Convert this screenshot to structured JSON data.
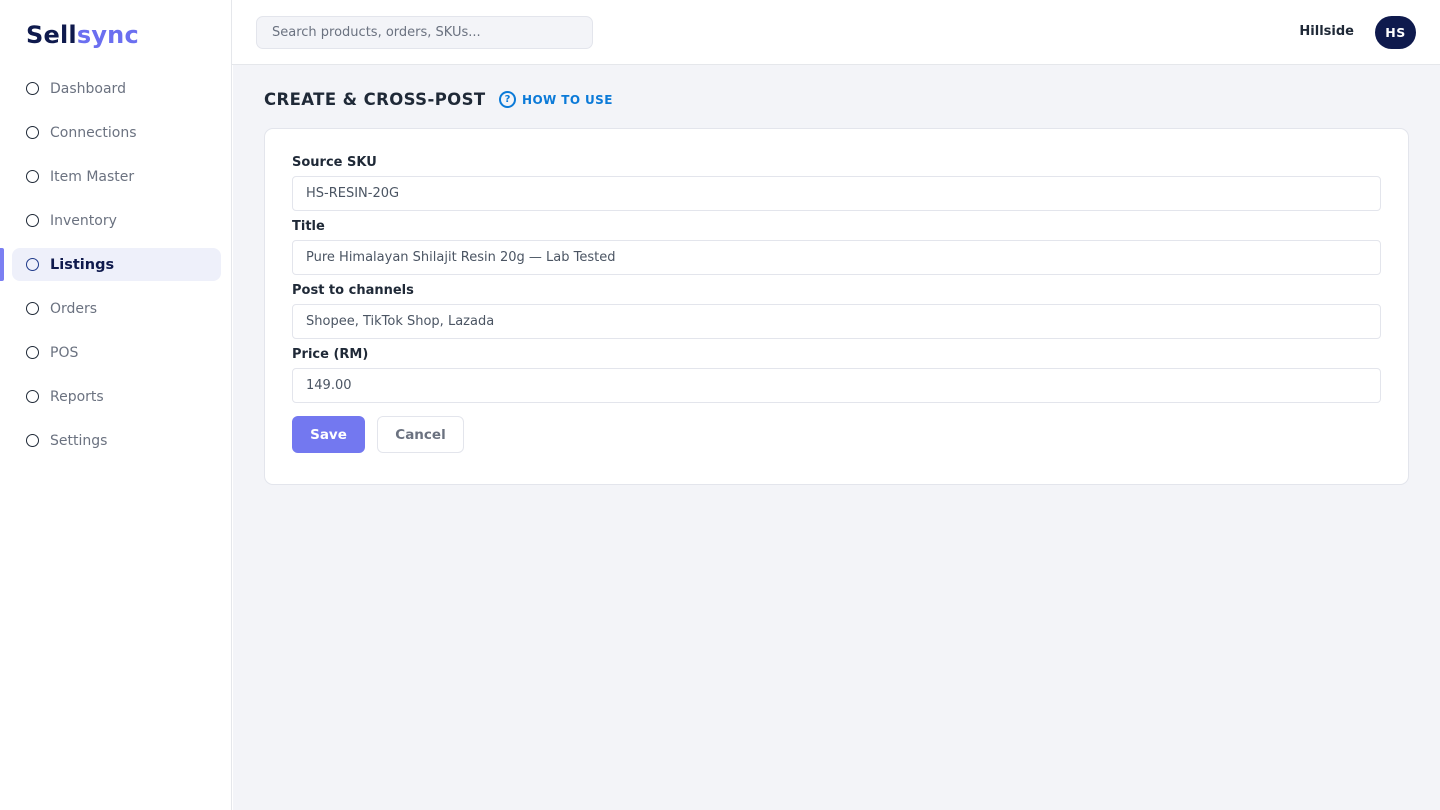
{
  "app": {
    "logo_part1": "Sell",
    "logo_part2": "sync"
  },
  "colors": {
    "brand_dark": "#0f1a4d",
    "accent": "#7378f0",
    "link": "#0b7ad8"
  },
  "sidebar": {
    "items": [
      {
        "label": "Dashboard",
        "icon": "circle-icon",
        "active": false
      },
      {
        "label": "Connections",
        "icon": "circle-icon",
        "active": false
      },
      {
        "label": "Item Master",
        "icon": "circle-icon",
        "active": false
      },
      {
        "label": "Inventory",
        "icon": "circle-icon",
        "active": false
      },
      {
        "label": "Listings",
        "icon": "circle-icon",
        "active": true
      },
      {
        "label": "Orders",
        "icon": "circle-icon",
        "active": false
      },
      {
        "label": "POS",
        "icon": "circle-icon",
        "active": false
      },
      {
        "label": "Reports",
        "icon": "circle-icon",
        "active": false
      },
      {
        "label": "Settings",
        "icon": "circle-icon",
        "active": false
      }
    ]
  },
  "topbar": {
    "search_placeholder": "Search products, orders, SKUs...",
    "org_name": "Hillside",
    "avatar_initials": "HS"
  },
  "page": {
    "title": "CREATE & CROSS-POST",
    "help_label": "HOW TO USE",
    "help_icon": "question-circle-icon"
  },
  "form": {
    "fields": [
      {
        "label": "Source SKU",
        "value": "HS-RESIN-20G"
      },
      {
        "label": "Title",
        "value": "Pure Himalayan Shilajit Resin 20g — Lab Tested"
      },
      {
        "label": "Post to channels",
        "value": "Shopee, TikTok Shop, Lazada"
      },
      {
        "label": "Price (RM)",
        "value": "149.00"
      }
    ],
    "save_label": "Save",
    "cancel_label": "Cancel"
  }
}
